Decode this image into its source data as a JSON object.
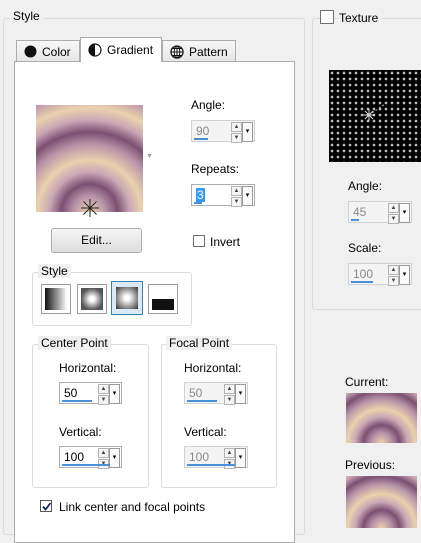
{
  "style_group": {
    "title": "Style",
    "tabs": [
      {
        "label": "Color",
        "icon": "color-circle-icon"
      },
      {
        "label": "Gradient",
        "icon": "gradient-circle-icon"
      },
      {
        "label": "Pattern",
        "icon": "pattern-globe-icon"
      }
    ],
    "active_tab": "Gradient",
    "angle_label": "Angle:",
    "angle_value": "90",
    "repeats_label": "Repeats:",
    "repeats_value": "3",
    "edit_label": "Edit...",
    "invert_label": "Invert",
    "invert_checked": false,
    "style_title": "Style",
    "style_options": [
      "linear-gradient-icon",
      "rectangular-gradient-icon",
      "sunburst-gradient-icon",
      "radial-gradient-icon"
    ],
    "selected_style": "sunburst-gradient-icon",
    "center_point": {
      "title": "Center Point",
      "horizontal_label": "Horizontal:",
      "horizontal_value": "50",
      "vertical_label": "Vertical:",
      "vertical_value": "100"
    },
    "focal_point": {
      "title": "Focal Point",
      "horizontal_label": "Horizontal:",
      "horizontal_value": "50",
      "vertical_label": "Vertical:",
      "vertical_value": "100"
    },
    "link_label": "Link center and focal points",
    "link_checked": true
  },
  "texture": {
    "label": "Texture",
    "checked": false,
    "angle_label": "Angle:",
    "angle_value": "45",
    "scale_label": "Scale:",
    "scale_value": "100"
  },
  "preview": {
    "current_label": "Current:",
    "previous_label": "Previous:"
  },
  "colors": {
    "gradient_cream": "#e9d2ad",
    "gradient_mauve": "#7c4f72",
    "accent_blue": "#4a90d9"
  }
}
